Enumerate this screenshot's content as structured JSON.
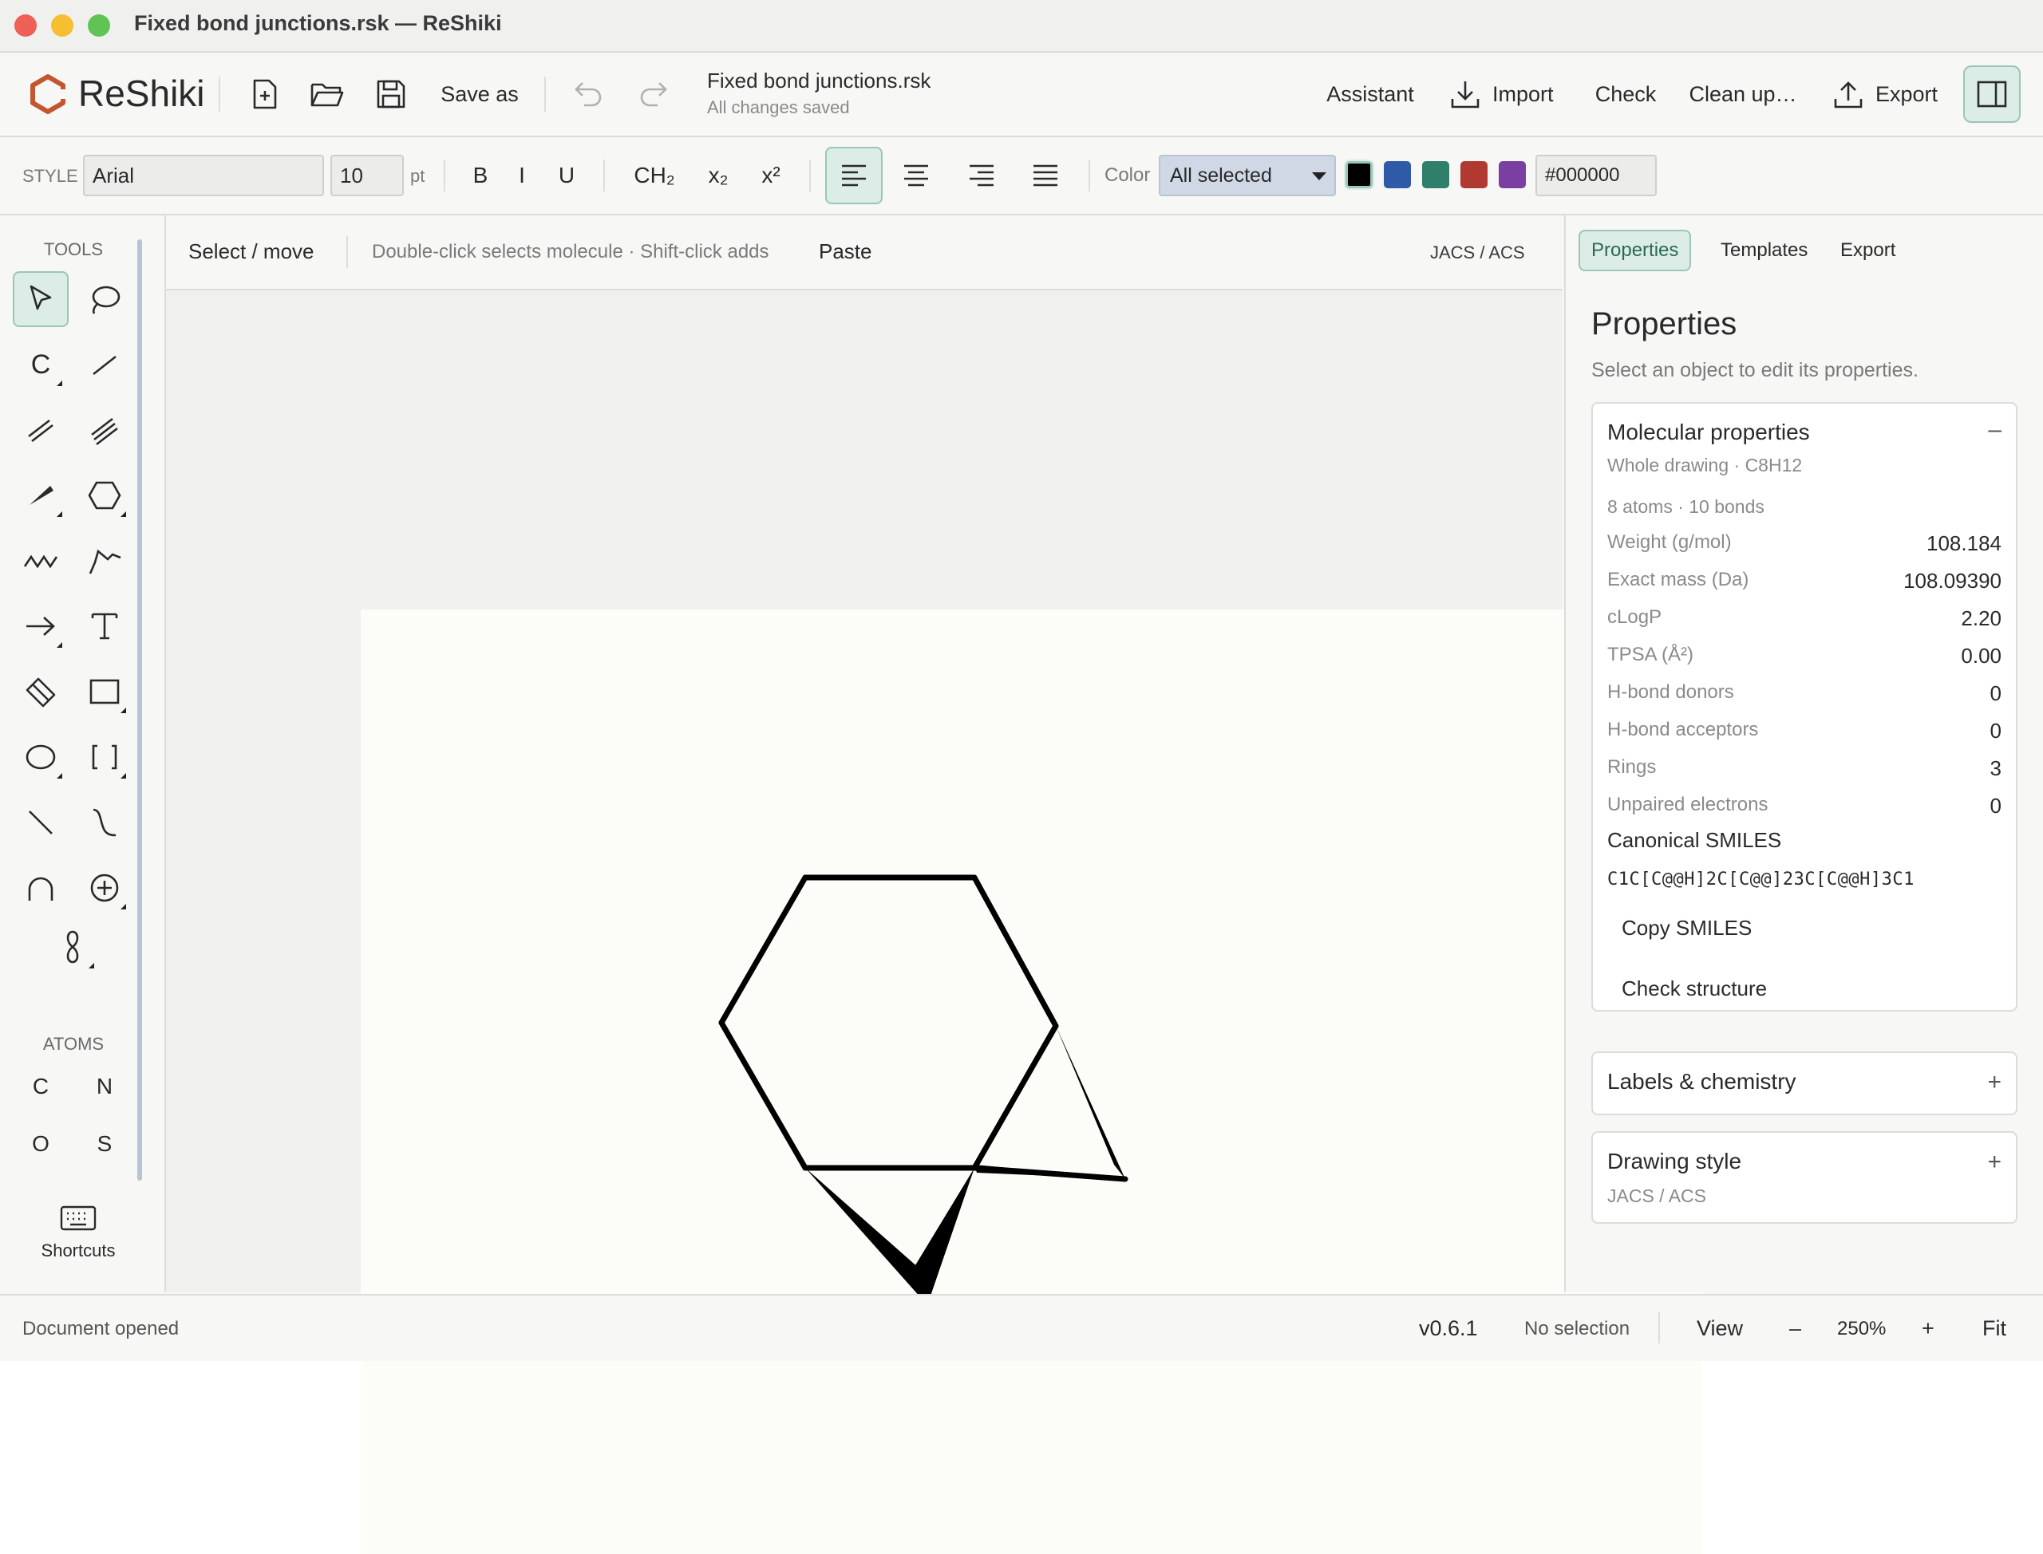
{
  "window": {
    "title": "Fixed bond junctions.rsk — ReShiki"
  },
  "app": {
    "name": "ReShiki"
  },
  "header": {
    "save_as": "Save as",
    "doc_name": "Fixed bond junctions.rsk",
    "doc_status": "All changes saved",
    "assistant": "Assistant",
    "import": "Import",
    "check": "Check",
    "cleanup": "Clean up…",
    "export": "Export"
  },
  "stylebar": {
    "style_label": "STYLE",
    "font": "Arial",
    "size": "10",
    "unit": "pt",
    "bold": "B",
    "italic": "I",
    "underline": "U",
    "ch2": "CH₂",
    "subscript": "x₂",
    "superscript": "x²",
    "color_label": "Color",
    "color_scope": "All selected",
    "hex": "#000000",
    "swatches": [
      "#000000",
      "#2f5aa8",
      "#2f7f6a",
      "#b03a32",
      "#7a3fa0"
    ]
  },
  "tools": {
    "label": "TOOLS",
    "carbon_tool": "C",
    "atoms_label": "ATOMS",
    "atoms": [
      "C",
      "N",
      "O",
      "S"
    ],
    "shortcuts": "Shortcuts"
  },
  "canvas": {
    "mode": "Select / move",
    "hint": "Double-click selects molecule · Shift-click adds",
    "paste": "Paste",
    "style_name": "JACS / ACS"
  },
  "panel": {
    "tabs": [
      "Properties",
      "Templates",
      "Export"
    ],
    "title": "Properties",
    "subtitle": "Select an object to edit its properties.",
    "molecular": {
      "title": "Molecular properties",
      "scope": "Whole drawing · C8H12",
      "counts": "8 atoms · 10 bonds",
      "rows": [
        {
          "k": "Weight (g/mol)",
          "v": "108.184"
        },
        {
          "k": "Exact mass (Da)",
          "v": "108.09390"
        },
        {
          "k": "cLogP",
          "v": "2.20"
        },
        {
          "k": "TPSA (Å²)",
          "v": "0.00"
        },
        {
          "k": "H-bond donors",
          "v": "0"
        },
        {
          "k": "H-bond acceptors",
          "v": "0"
        },
        {
          "k": "Rings",
          "v": "3"
        },
        {
          "k": "Unpaired electrons",
          "v": "0"
        }
      ],
      "smiles_label": "Canonical SMILES",
      "smiles": "C1C[C@@H]2C[C@@]23C[C@@H]3C1",
      "copy": "Copy SMILES",
      "check": "Check structure",
      "toggle": "–"
    },
    "labels": {
      "title": "Labels & chemistry",
      "toggle": "+"
    },
    "drawing": {
      "title": "Drawing style",
      "sub": "JACS / ACS",
      "toggle": "+"
    }
  },
  "status": {
    "message": "Document opened",
    "version": "v0.6.1",
    "selection": "No selection",
    "view": "View",
    "zoom_out": "–",
    "zoom": "250%",
    "zoom_in": "+",
    "fit": "Fit"
  }
}
